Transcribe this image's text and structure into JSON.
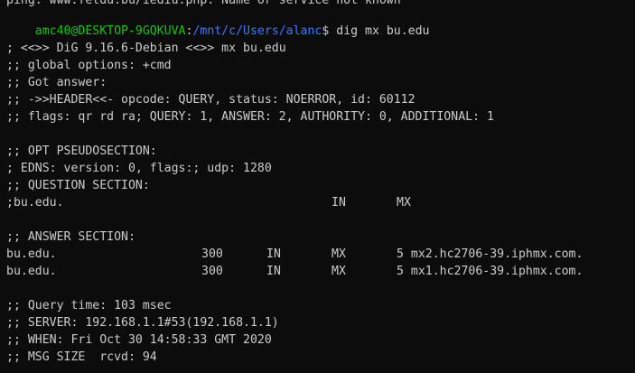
{
  "cutoff_line": "ping: www.fetdu.bu/iediu.php: Name or service not known",
  "prompt": {
    "user_host": "amc40@DESKTOP-9GQKUVA",
    "separator": ":",
    "path": "/mnt/c/Users/alanc",
    "symbol": "$",
    "command": " dig mx bu.edu"
  },
  "header_lines": [
    "; <<>> DiG 9.16.6-Debian <<>> mx bu.edu",
    ";; global options: +cmd",
    ";; Got answer:",
    ";; ->>HEADER<<- opcode: QUERY, status: NOERROR, id: 60112",
    ";; flags: qr rd ra; QUERY: 1, ANSWER: 2, AUTHORITY: 0, ADDITIONAL: 1"
  ],
  "opt_lines": [
    ";; OPT PSEUDOSECTION:",
    "; EDNS: version: 0, flags:; udp: 1280",
    ";; QUESTION SECTION:"
  ],
  "question_row": {
    "name": ";bu.edu.",
    "class": "IN",
    "type": "MX"
  },
  "answer_section_title": ";; ANSWER SECTION:",
  "answer_rows": [
    {
      "name": "bu.edu.",
      "ttl": "300",
      "class": "IN",
      "type": "MX",
      "data": "5 mx2.hc2706-39.iphmx.com."
    },
    {
      "name": "bu.edu.",
      "ttl": "300",
      "class": "IN",
      "type": "MX",
      "data": "5 mx1.hc2706-39.iphmx.com."
    }
  ],
  "footer_lines": [
    ";; Query time: 103 msec",
    ";; SERVER: 192.168.1.1#53(192.168.1.1)",
    ";; WHEN: Fri Oct 30 14:58:33 GMT 2020",
    ";; MSG SIZE  rcvd: 94"
  ],
  "colors": {
    "background": "#0c0c0c",
    "text": "#cccccc",
    "prompt_user": "#16c60c",
    "prompt_path": "#3b78ff"
  }
}
